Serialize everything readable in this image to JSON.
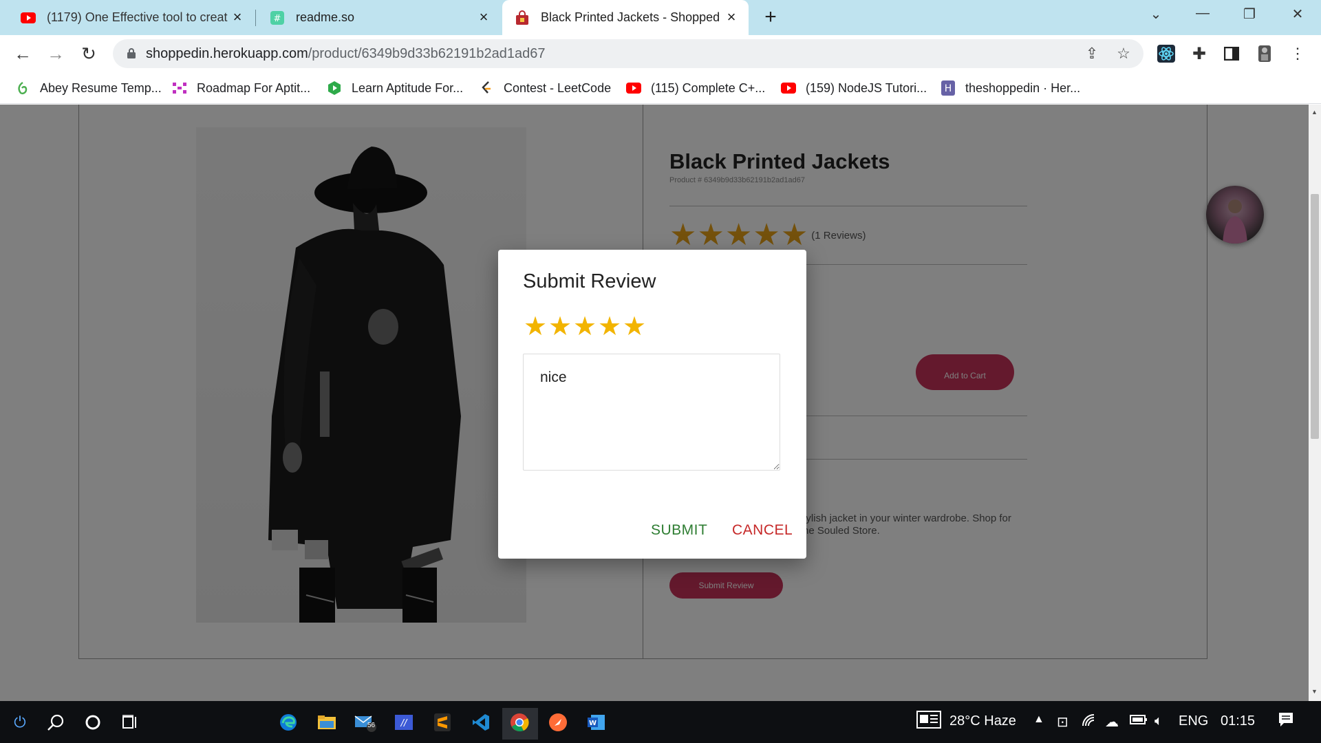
{
  "browser": {
    "tabs": [
      {
        "title": "(1179) One Effective tool to creat",
        "icon": "youtube-icon"
      },
      {
        "title": "readme.so",
        "icon": "readme-icon"
      },
      {
        "title": "Black Printed Jackets - ShoppedIn",
        "icon": "shoppedin-icon",
        "active": true
      }
    ],
    "url_domain": "shoppedin.herokuapp.com",
    "url_path": "/product/6349b9d33b62191b2ad1ad67",
    "bookmarks": [
      {
        "label": "Abey Resume Temp...",
        "icon": "overleaf-icon"
      },
      {
        "label": "Roadmap For Aptit...",
        "icon": "roadmap-icon"
      },
      {
        "label": "Learn Aptitude For...",
        "icon": "aptitude-icon"
      },
      {
        "label": "Contest - LeetCode",
        "icon": "leetcode-icon"
      },
      {
        "label": "(115) Complete C+...",
        "icon": "youtube-icon"
      },
      {
        "label": "(159) NodeJS Tutori...",
        "icon": "youtube-icon"
      },
      {
        "label": "theshoppedin · Her...",
        "icon": "heroku-icon"
      }
    ]
  },
  "product": {
    "title": "Black Printed Jackets",
    "product_id": "Product # 6349b9d33b62191b2ad1ad67",
    "rating": 5,
    "reviews_label": "(1 Reviews)",
    "add_to_cart": "Add to Cart",
    "description_line1": "cket Trust us, you need this stylish jacket in your winter wardrobe. Shop for",
    "description_line2": "dia, available exclusively at The Souled Store.",
    "submit_review": "Submit Review"
  },
  "dialog": {
    "title": "Submit Review",
    "rating": 5,
    "review_text": "nice",
    "submit": "SUBMIT",
    "cancel": "CANCEL"
  },
  "taskbar": {
    "weather": "28°C  Haze",
    "language": "ENG",
    "time": "01:15",
    "mail_badge": "56"
  },
  "colors": {
    "accent": "#c9335a",
    "star": "#f2b400",
    "submit": "#2e7d32",
    "cancel": "#c62828"
  }
}
